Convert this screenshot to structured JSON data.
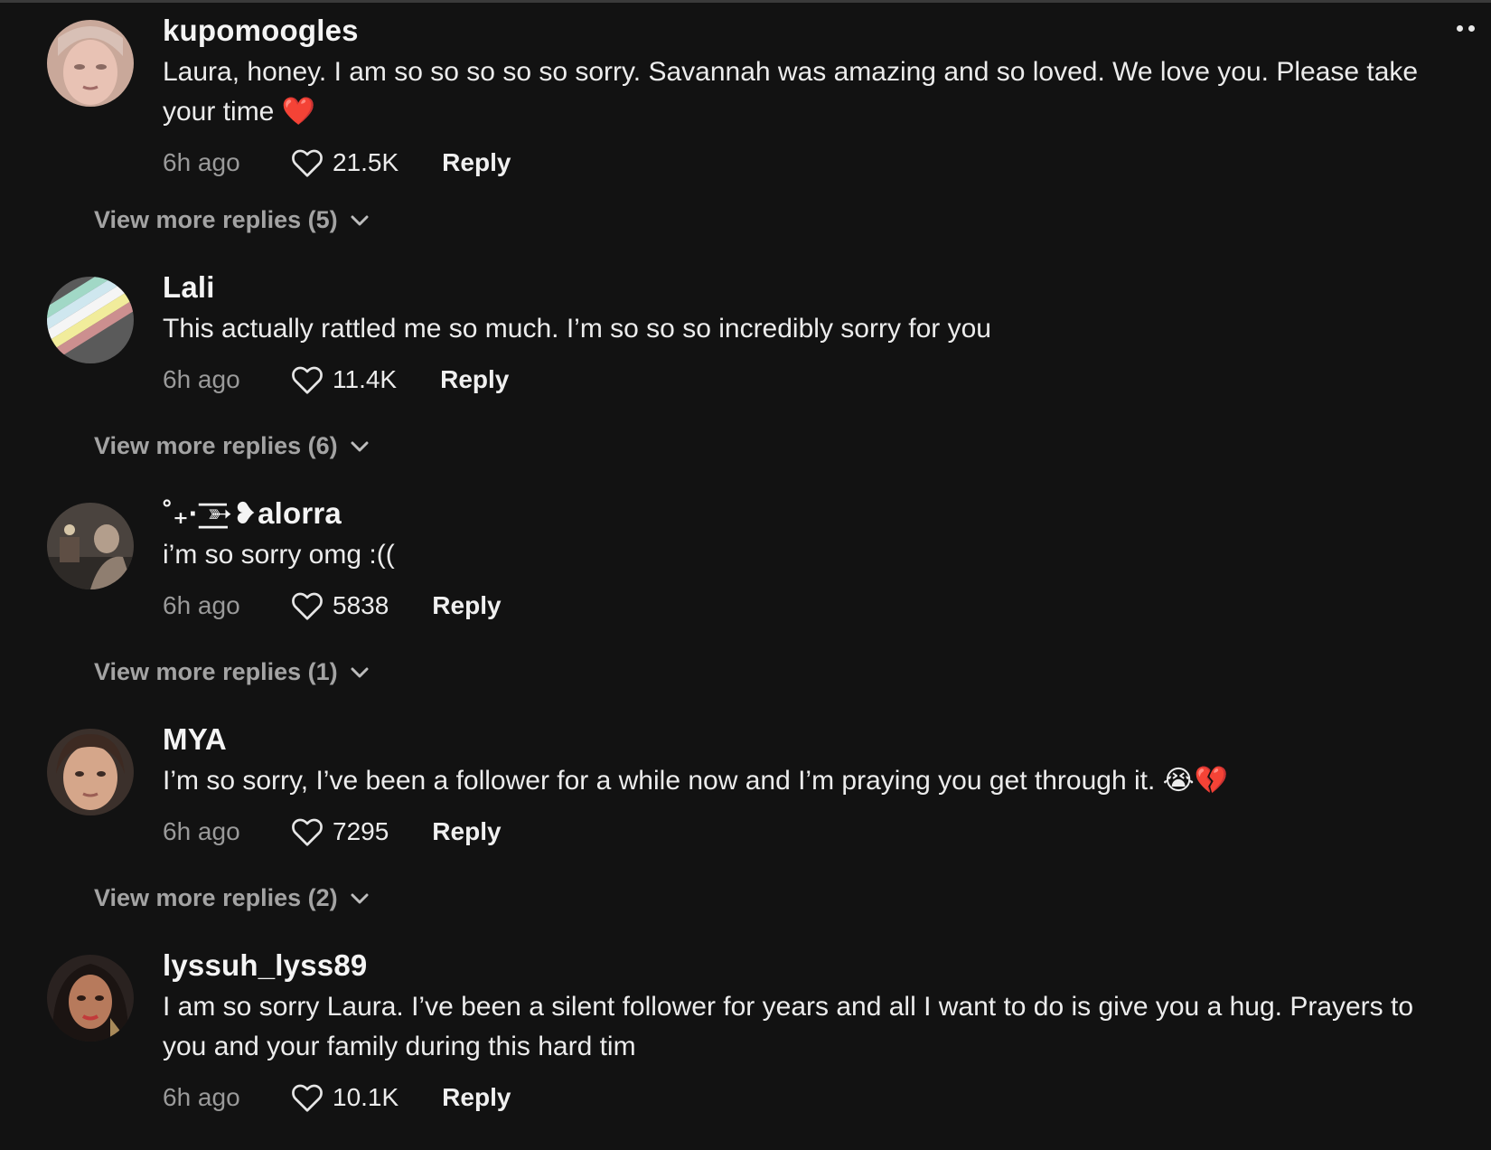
{
  "comments": [
    {
      "username": "kupomoogles",
      "text": "Laura, honey. I am so so so so so sorry. Savannah was amazing and so loved. We love you. Please take your time ❤️",
      "time": "6h ago",
      "likes": "21.5K",
      "reply_label": "Reply",
      "view_more": "View more replies (5)"
    },
    {
      "username": "Lali",
      "text": "This actually rattled me so much. I’m so so so incredibly sorry for you",
      "time": "6h ago",
      "likes": "11.4K",
      "reply_label": "Reply",
      "view_more": "View more replies (6)"
    },
    {
      "username": "˚₊· ͟͟͞͞➳❥alorra",
      "text": "i’m so sorry omg :((",
      "time": "6h ago",
      "likes": "5838",
      "reply_label": "Reply",
      "view_more": "View more replies (1)"
    },
    {
      "username": "MYA",
      "text": "I’m so sorry, I’ve been a follower for a while now and I’m praying you get through it. 😭💔",
      "time": "6h ago",
      "likes": "7295",
      "reply_label": "Reply",
      "view_more": "View more replies (2)"
    },
    {
      "username": "lyssuh_lyss89",
      "text": "I am so sorry Laura. I’ve been a silent follower for years and all I want to do is give you a hug. Prayers to you and your family during this hard tim",
      "time": "6h ago",
      "likes": "10.1K",
      "reply_label": "Reply"
    }
  ],
  "icons": {
    "like": "heart-outline-icon",
    "expand": "chevron-down-icon",
    "more": "more-options-icon"
  },
  "colors": {
    "background": "#121212",
    "text": "#ececec",
    "muted": "#9a9a9a"
  }
}
